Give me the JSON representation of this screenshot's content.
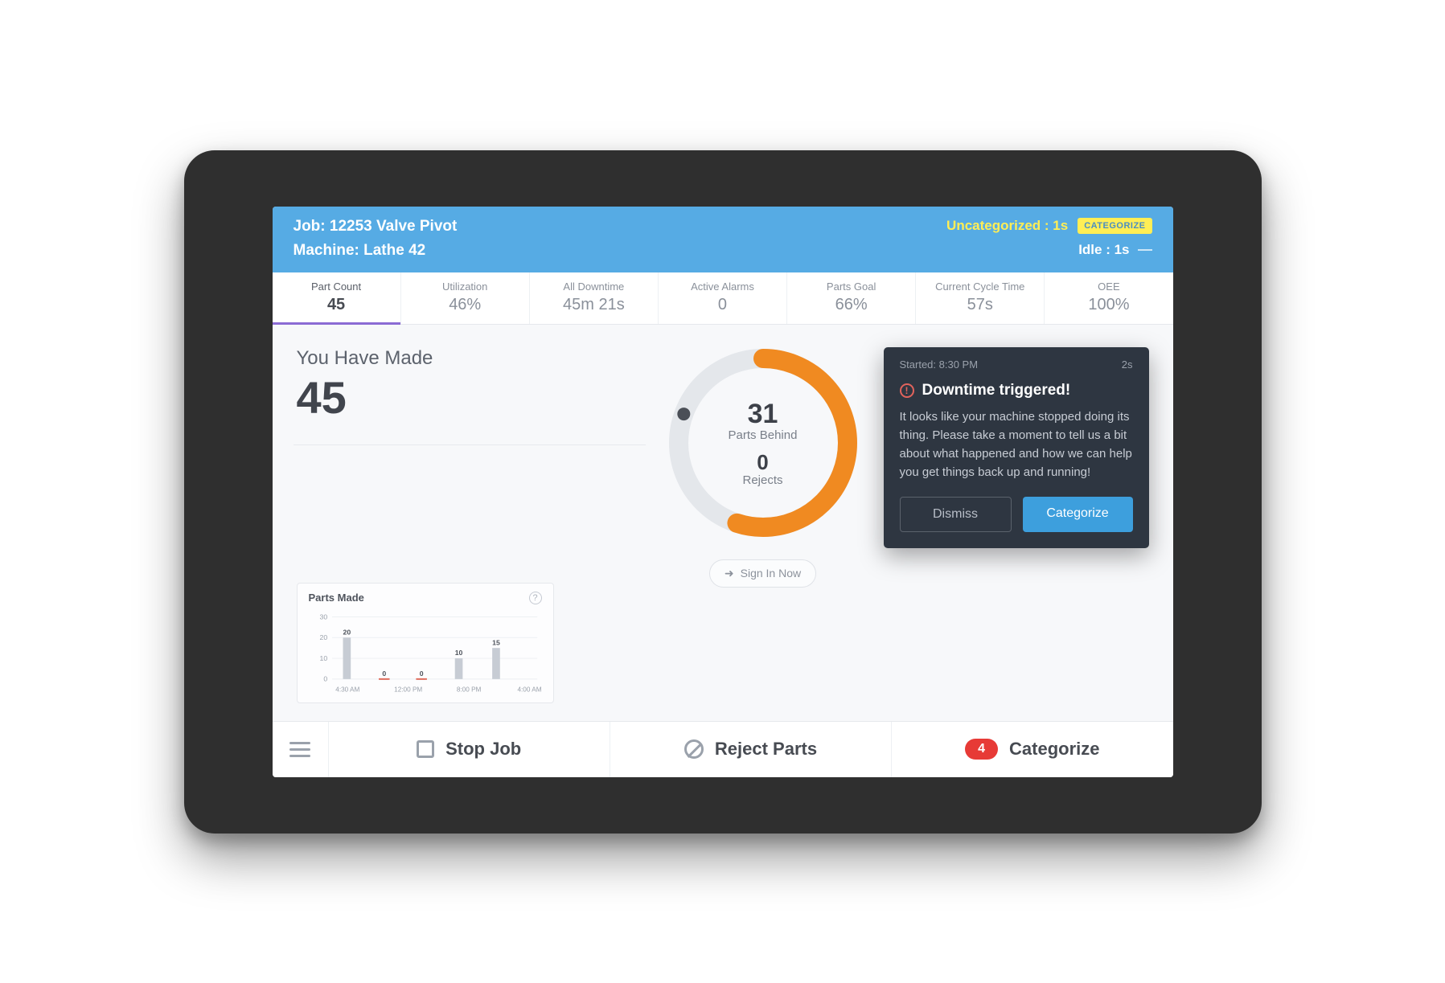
{
  "header": {
    "job_label": "Job: 12253 Valve Pivot",
    "machine_label": "Machine: Lathe 42",
    "uncategorized_label": "Uncategorized : 1s",
    "categorize_chip": "CATEGORIZE",
    "idle_label": "Idle : 1s"
  },
  "kpis": [
    {
      "label": "Part Count",
      "value": "45",
      "active": true
    },
    {
      "label": "Utilization",
      "value": "46%",
      "active": false
    },
    {
      "label": "All Downtime",
      "value": "45m 21s",
      "active": false
    },
    {
      "label": "Active Alarms",
      "value": "0",
      "active": false
    },
    {
      "label": "Parts Goal",
      "value": "66%",
      "active": false
    },
    {
      "label": "Current Cycle Time",
      "value": "57s",
      "active": false
    },
    {
      "label": "OEE",
      "value": "100%",
      "active": false
    }
  ],
  "main": {
    "made_title": "You Have Made",
    "made_value": "45",
    "behind_value": "31",
    "behind_label": "Parts Behind",
    "rejects_value": "0",
    "rejects_label": "Rejects",
    "signin_label": "Sign In Now",
    "gauge_fraction": 0.55
  },
  "chart_card": {
    "title": "Parts Made"
  },
  "chart_data": {
    "type": "bar",
    "title": "Parts Made",
    "xlabel": "",
    "ylabel": "",
    "ylim": [
      0,
      30
    ],
    "yticks": [
      0,
      10,
      20,
      30
    ],
    "categories": [
      "4:30 AM",
      "12:00 PM",
      "8:00 PM",
      "4:00 AM"
    ],
    "series": [
      {
        "name": "parts",
        "values": [
          20,
          0,
          0,
          10,
          15
        ]
      }
    ],
    "data_labels": [
      "20",
      "0",
      "0",
      "10",
      "15"
    ]
  },
  "toast": {
    "started_label": "Started:  8:30 PM",
    "elapsed": "2s",
    "title": "Downtime triggered!",
    "body": "It looks like your machine stopped doing its thing. Please take a moment to tell us a bit about what happened and how we can help you get things back up and running!",
    "dismiss": "Dismiss",
    "categorize": "Categorize"
  },
  "footer": {
    "stop_job": "Stop Job",
    "reject_parts": "Reject Parts",
    "categorize": "Categorize",
    "badge": "4"
  },
  "colors": {
    "accent_blue": "#56abe4",
    "gauge_orange": "#f08a21",
    "gauge_track": "#e4e7eb",
    "badge_red": "#e73a36",
    "kpi_underline": "#8b6bd4"
  }
}
